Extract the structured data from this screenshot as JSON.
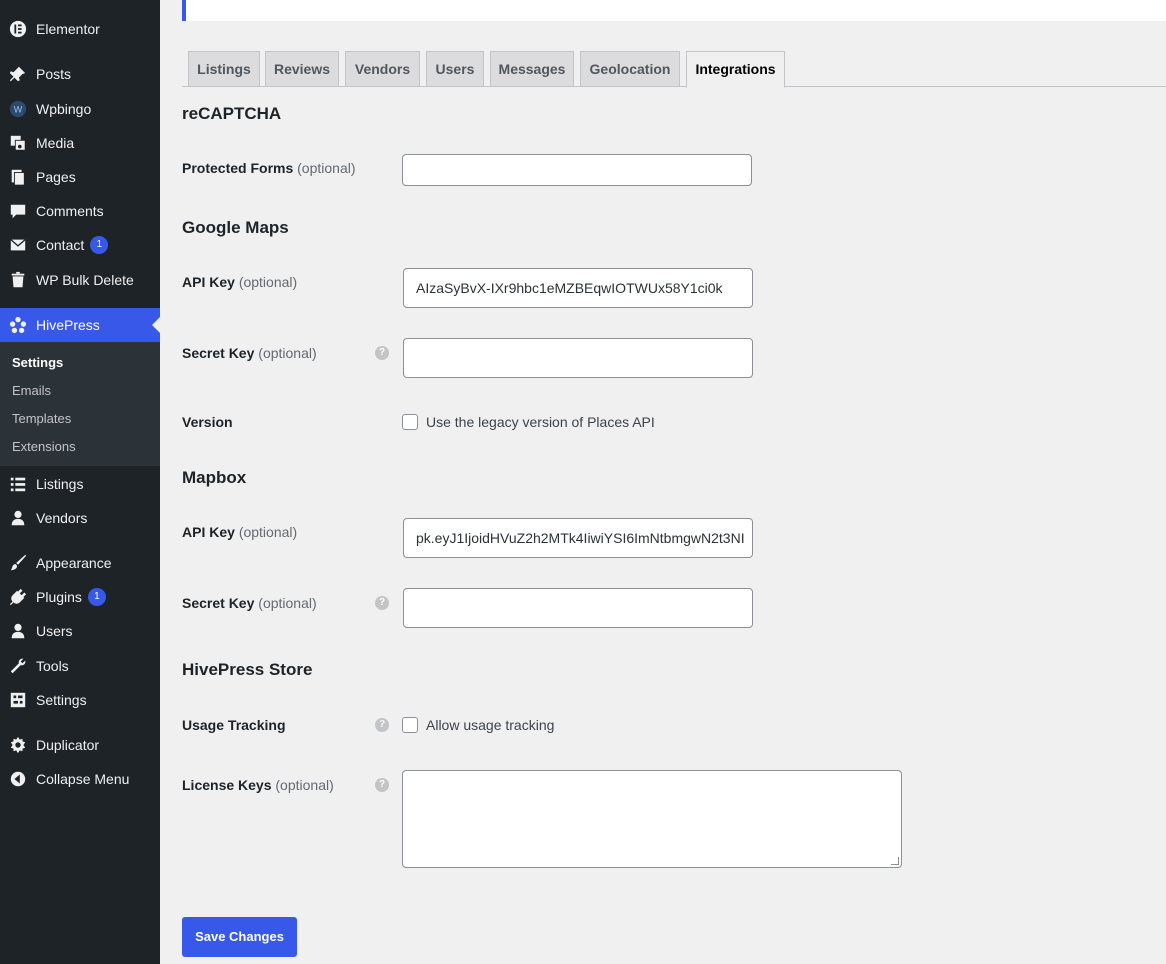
{
  "sidebar": {
    "items": [
      {
        "label": "Elementor",
        "icon": "elementor-icon"
      },
      {
        "label": "Posts",
        "icon": "pin-icon"
      },
      {
        "label": "Wpbingo",
        "icon": "wpbingo-icon"
      },
      {
        "label": "Media",
        "icon": "media-icon"
      },
      {
        "label": "Pages",
        "icon": "pages-icon"
      },
      {
        "label": "Comments",
        "icon": "comment-icon"
      },
      {
        "label": "Contact",
        "icon": "mail-icon",
        "badge": "1"
      },
      {
        "label": "WP Bulk Delete",
        "icon": "trash-icon"
      },
      {
        "label": "HivePress",
        "icon": "hivepress-icon"
      },
      {
        "label": "Listings",
        "icon": "list-icon"
      },
      {
        "label": "Vendors",
        "icon": "user-icon"
      },
      {
        "label": "Appearance",
        "icon": "brush-icon"
      },
      {
        "label": "Plugins",
        "icon": "plug-icon",
        "badge": "1"
      },
      {
        "label": "Users",
        "icon": "user-icon"
      },
      {
        "label": "Tools",
        "icon": "wrench-icon"
      },
      {
        "label": "Settings",
        "icon": "settings-icon"
      },
      {
        "label": "Duplicator",
        "icon": "duplicator-icon"
      },
      {
        "label": "Collapse Menu",
        "icon": "collapse-icon"
      }
    ],
    "submenu": [
      "Settings",
      "Emails",
      "Templates",
      "Extensions"
    ]
  },
  "tabs": [
    "Listings",
    "Reviews",
    "Vendors",
    "Users",
    "Messages",
    "Geolocation",
    "Integrations"
  ],
  "active_tab": "Integrations",
  "sections": {
    "recaptcha": {
      "title": "reCAPTCHA",
      "protected_forms_label": "Protected Forms",
      "optional": "(optional)"
    },
    "google_maps": {
      "title": "Google Maps",
      "api_key_label": "API Key",
      "api_key_value": "AIzaSyBvX-IXr9hbc1eMZBEqwIOTWUx58Y1ci0k",
      "secret_key_label": "Secret Key",
      "version_label": "Version",
      "version_checkbox": "Use the legacy version of Places API"
    },
    "mapbox": {
      "title": "Mapbox",
      "api_key_label": "API Key",
      "api_key_value": "pk.eyJ1IjoidHVuZ2h2MTk4IiwiYSI6ImNtbmgwN2t3NI",
      "secret_key_label": "Secret Key"
    },
    "store": {
      "title": "HivePress Store",
      "usage_label": "Usage Tracking",
      "usage_checkbox": "Allow usage tracking",
      "license_label": "License Keys"
    }
  },
  "optional_text": "(optional)",
  "help_glyph": "?",
  "save_button": "Save Changes",
  "colors": {
    "accent": "#3858e9",
    "sidebar_bg": "#1d2327",
    "content_bg": "#f0f0f1"
  }
}
